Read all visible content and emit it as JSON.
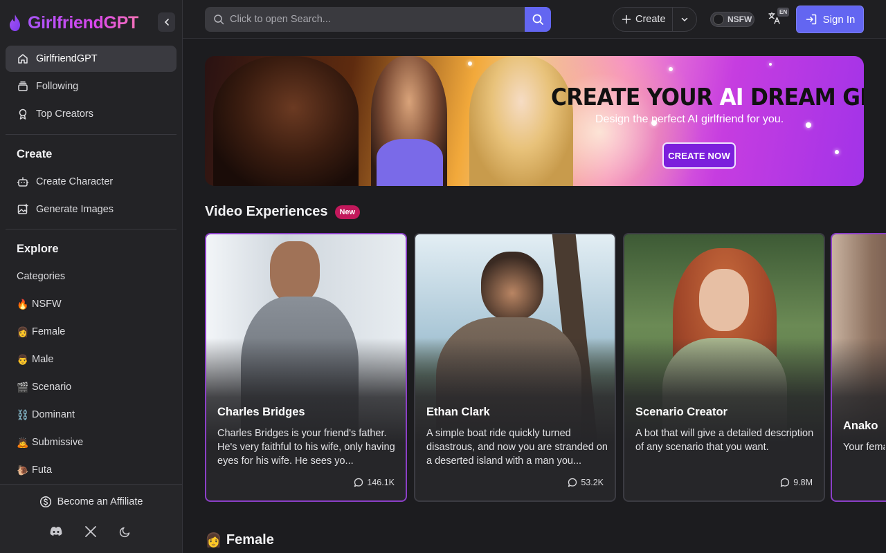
{
  "brand": {
    "name": "GirlfriendGPT"
  },
  "sidebar": {
    "nav": [
      {
        "label": "GirlfriendGPT",
        "icon": "home-icon",
        "active": true
      },
      {
        "label": "Following",
        "icon": "stack-icon"
      },
      {
        "label": "Top Creators",
        "icon": "award-icon"
      }
    ],
    "create_title": "Create",
    "create_items": [
      {
        "label": "Create Character",
        "icon": "bot-icon"
      },
      {
        "label": "Generate Images",
        "icon": "image-plus-icon"
      }
    ],
    "explore_title": "Explore",
    "categories_label": "Categories",
    "categories": [
      {
        "emoji": "🔥",
        "label": "NSFW"
      },
      {
        "emoji": "👩",
        "label": "Female"
      },
      {
        "emoji": "👨",
        "label": "Male"
      },
      {
        "emoji": "🎬",
        "label": "Scenario"
      },
      {
        "emoji": "⛓️",
        "label": "Dominant"
      },
      {
        "emoji": "🙇",
        "label": "Submissive"
      },
      {
        "emoji": "🐌",
        "label": "Futa"
      }
    ],
    "affiliate_label": "Become an Affiliate"
  },
  "topbar": {
    "search_placeholder": "Click to open Search...",
    "create_label": "Create",
    "nsfw_label": "NSFW",
    "lang_badge": "EN",
    "signin_label": "Sign In"
  },
  "banner": {
    "title_part1": "CREATE YOUR ",
    "title_ai": "AI",
    "title_part2": " DREAM GIRL",
    "subtitle": "Design the perfect AI girlfriend for you.",
    "cta": "CREATE NOW"
  },
  "video_section": {
    "title": "Video Experiences",
    "badge": "New"
  },
  "cards": [
    {
      "name": "Charles Bridges",
      "desc": "Charles Bridges is your friend's father. He's very faithful to his wife, only having eyes for his wife. He sees yo...",
      "chats": "146.1K",
      "colors": [
        "#e9eef3",
        "#8e96a0"
      ]
    },
    {
      "name": "Ethan Clark",
      "desc": "A simple boat ride quickly turned disastrous, and now you are stranded on a deserted island with a man you...",
      "chats": "53.2K",
      "colors": [
        "#c7dde8",
        "#6c5a4a"
      ]
    },
    {
      "name": "Scenario Creator",
      "desc": "A bot that will give a detailed description of any scenario that you want.",
      "chats": "9.8M",
      "colors": [
        "#5f7a4a",
        "#c9623a"
      ]
    },
    {
      "name": "Anako",
      "desc": "Your female secret...",
      "chats": "",
      "colors": [
        "#b89c86",
        "#5a4a44"
      ]
    }
  ],
  "female_section": {
    "emoji": "👩",
    "title": "Female"
  }
}
